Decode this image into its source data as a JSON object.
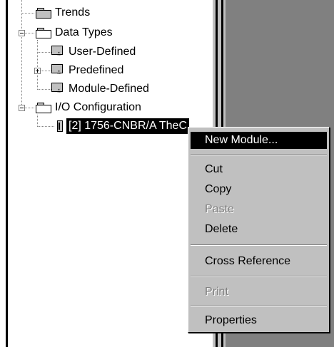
{
  "tree": {
    "items": [
      {
        "label": "Trends"
      },
      {
        "label": "Data Types"
      },
      {
        "label": "User-Defined"
      },
      {
        "label": "Predefined"
      },
      {
        "label": "Module-Defined"
      },
      {
        "label": "I/O Configuration"
      },
      {
        "label": "[2] 1756-CNBR/A TheC"
      }
    ]
  },
  "context_menu": {
    "items": [
      {
        "label": "New Module...",
        "state": "highlighted"
      },
      {
        "label": "Cut",
        "state": "enabled"
      },
      {
        "label": "Copy",
        "state": "enabled"
      },
      {
        "label": "Paste",
        "state": "disabled"
      },
      {
        "label": "Delete",
        "state": "enabled"
      },
      {
        "label": "Cross Reference",
        "state": "enabled"
      },
      {
        "label": "Print",
        "state": "disabled"
      },
      {
        "label": "Properties",
        "state": "enabled"
      }
    ]
  },
  "colors": {
    "menu_bg": "#c0c0c0",
    "highlight": "#000000",
    "disabled_text": "#808080",
    "right_pane": "#808080"
  }
}
